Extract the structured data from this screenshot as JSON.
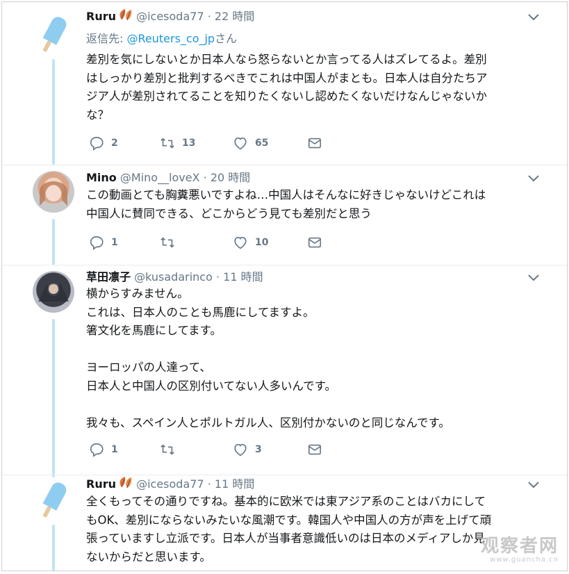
{
  "tweets": [
    {
      "name": "Ruru",
      "handle": "@icesoda77",
      "dot": "·",
      "time": "22 時間",
      "reply_prefix": "返信先: ",
      "reply_to": "@Reuters_co_jp",
      "reply_suffix": "さん",
      "text": "差別を気にしないとか日本人なら怒らないとか言ってる人はズレてるよ。差別\nはしっかり差別と批判するべきでこれは中国人がまとも。日本人は自分たちア\nジア人が差別されてることを知りたくないし認めたくないだけなんじゃないか\nな？",
      "replies": "2",
      "retweets": "13",
      "likes": "65"
    },
    {
      "name": "Mino",
      "handle": "@Mino__loveX",
      "dot": "·",
      "time": "20 時間",
      "text": "この動画とても胸糞悪いですよね…中国人はそんなに好きじゃないけどこれは\n中国人に賛同できる、どこからどう見ても差別だと思う",
      "replies": "1",
      "retweets": "",
      "likes": "10"
    },
    {
      "name": "草田凛子",
      "handle": "@kusadarinco",
      "dot": "·",
      "time": "11 時間",
      "text": "横からすみません。\nこれは、日本人のことも馬鹿にしてますよ。\n箸文化を馬鹿にしてます。\n\nヨーロッパの人達って、\n日本人と中国人の区別付いてない人多いんです。\n\n我々も、スペイン人とポルトガル人、区別付かないのと同じなんです。",
      "replies": "1",
      "retweets": "",
      "likes": "3"
    },
    {
      "name": "Ruru",
      "handle": "@icesoda77",
      "dot": "·",
      "time": "11 時間",
      "text": "全くもってその通りですね。基本的に欧米では東アジア系のことはバカにして\nもOK、差別にならないみたいな風潮です。韓国人や中国人の方が声を上げて頑\n張っていますし立派です。日本人が当事者意識低いのは日本のメディアしか見\nないからだと思います。"
    }
  ],
  "watermark": {
    "line1": "观察者网",
    "line2": "www.guancha.cn"
  },
  "colors": {
    "link": "#1b95e0",
    "muted": "#657786",
    "thread": "#c2e3f5",
    "popsicle": "#8fcdf0"
  }
}
